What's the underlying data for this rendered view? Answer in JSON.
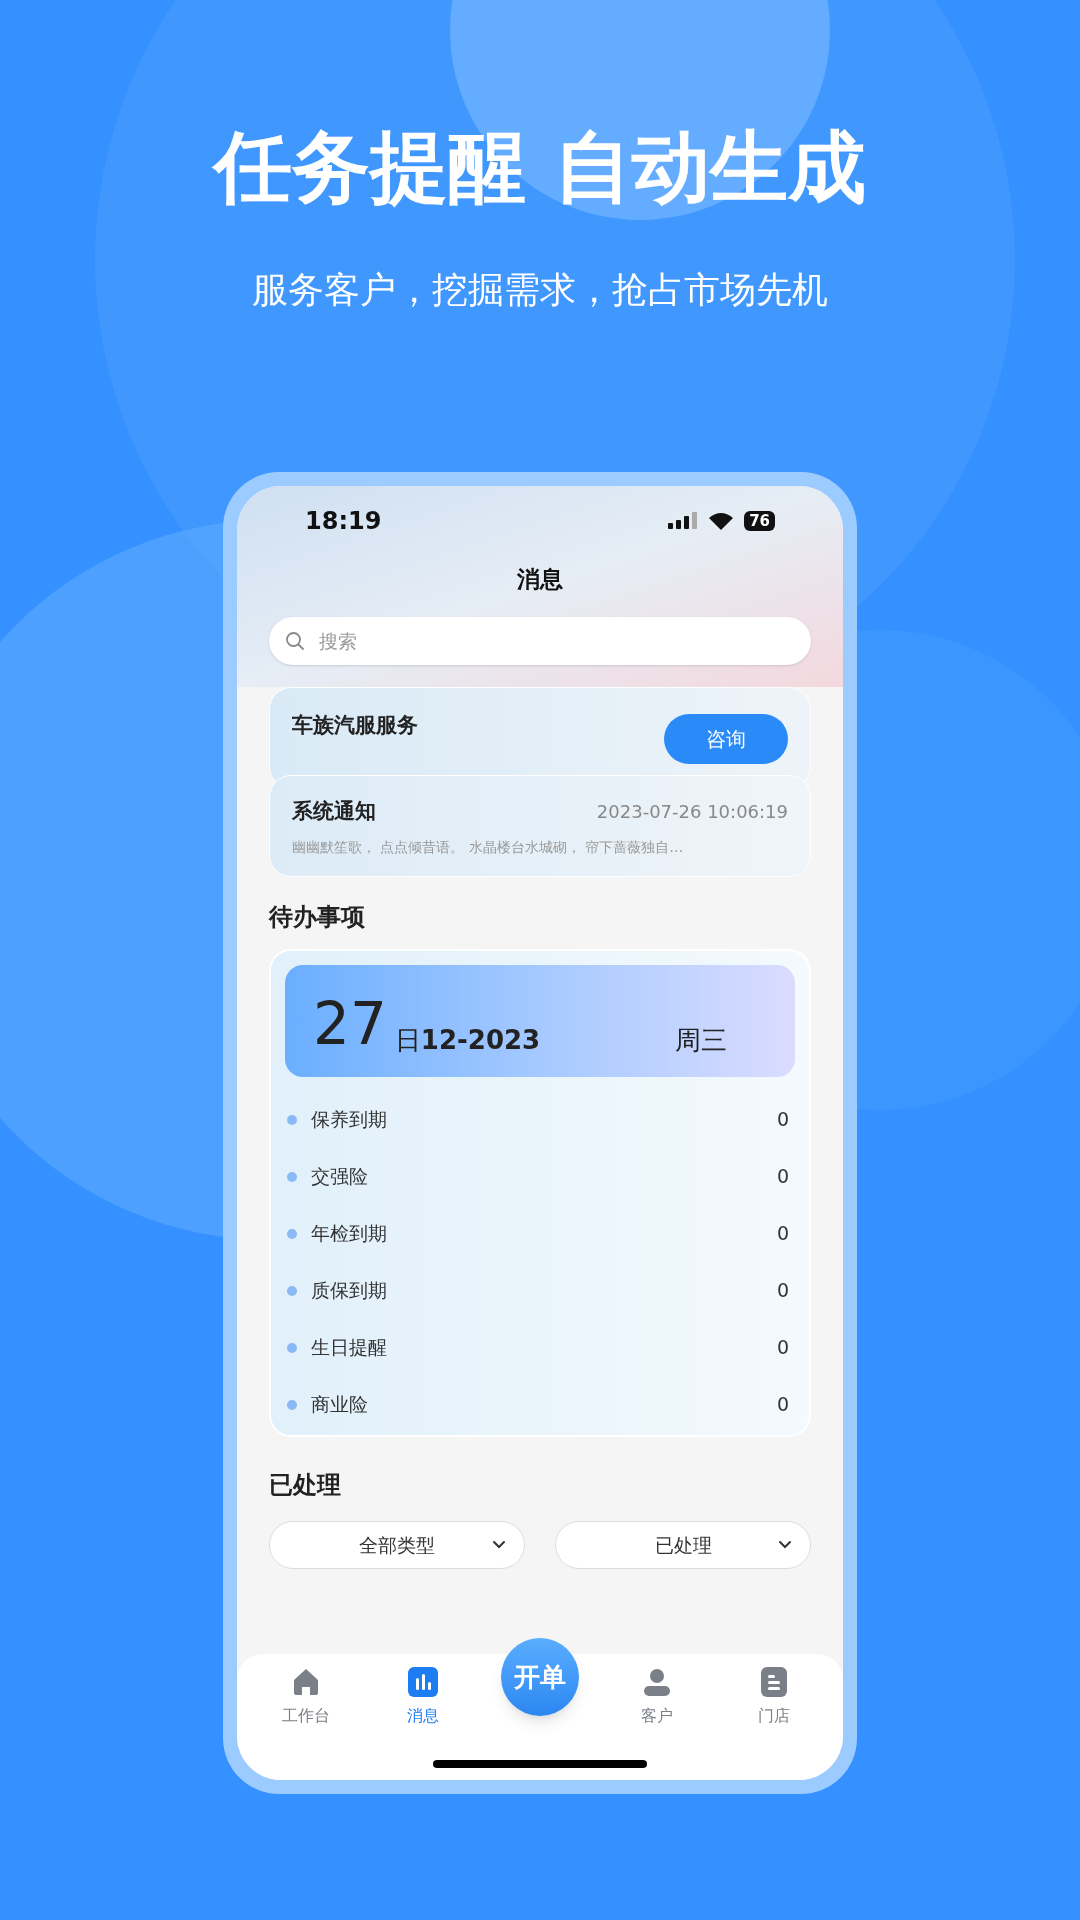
{
  "headline": "任务提醒 自动生成",
  "subtitle": "服务客户，挖掘需求，抢占市场先机",
  "status_bar": {
    "time": "18:19",
    "battery": "76"
  },
  "title": "消息",
  "search": {
    "placeholder": "搜索"
  },
  "service_card": {
    "title": "车族汽服服务",
    "button": "咨询"
  },
  "notice": {
    "title": "系统通知",
    "time": "2023-07-26 10:06:19",
    "preview": "幽幽默笙歌， 点点倾昔语。 水晶楼台水城砌， 帘下蔷薇独自…"
  },
  "todo": {
    "heading": "待办事项",
    "day": "27",
    "day_unit": "日",
    "month_year": "12-2023",
    "weekday": "周三",
    "items": [
      {
        "label": "保养到期",
        "count": "0"
      },
      {
        "label": "交强险",
        "count": "0"
      },
      {
        "label": "年检到期",
        "count": "0"
      },
      {
        "label": "质保到期",
        "count": "0"
      },
      {
        "label": "生日提醒",
        "count": "0"
      },
      {
        "label": "商业险",
        "count": "0"
      }
    ]
  },
  "processed": {
    "heading": "已处理",
    "filters": [
      "全部类型",
      "已处理"
    ]
  },
  "tab_bar": [
    {
      "kind": "tab",
      "label": "工作台",
      "selected": false
    },
    {
      "kind": "tab",
      "label": "消息",
      "selected": true
    },
    {
      "kind": "action",
      "label": "开单",
      "selected": false
    },
    {
      "kind": "tab",
      "label": "客户",
      "selected": false
    },
    {
      "kind": "tab",
      "label": "门店",
      "selected": false
    }
  ]
}
